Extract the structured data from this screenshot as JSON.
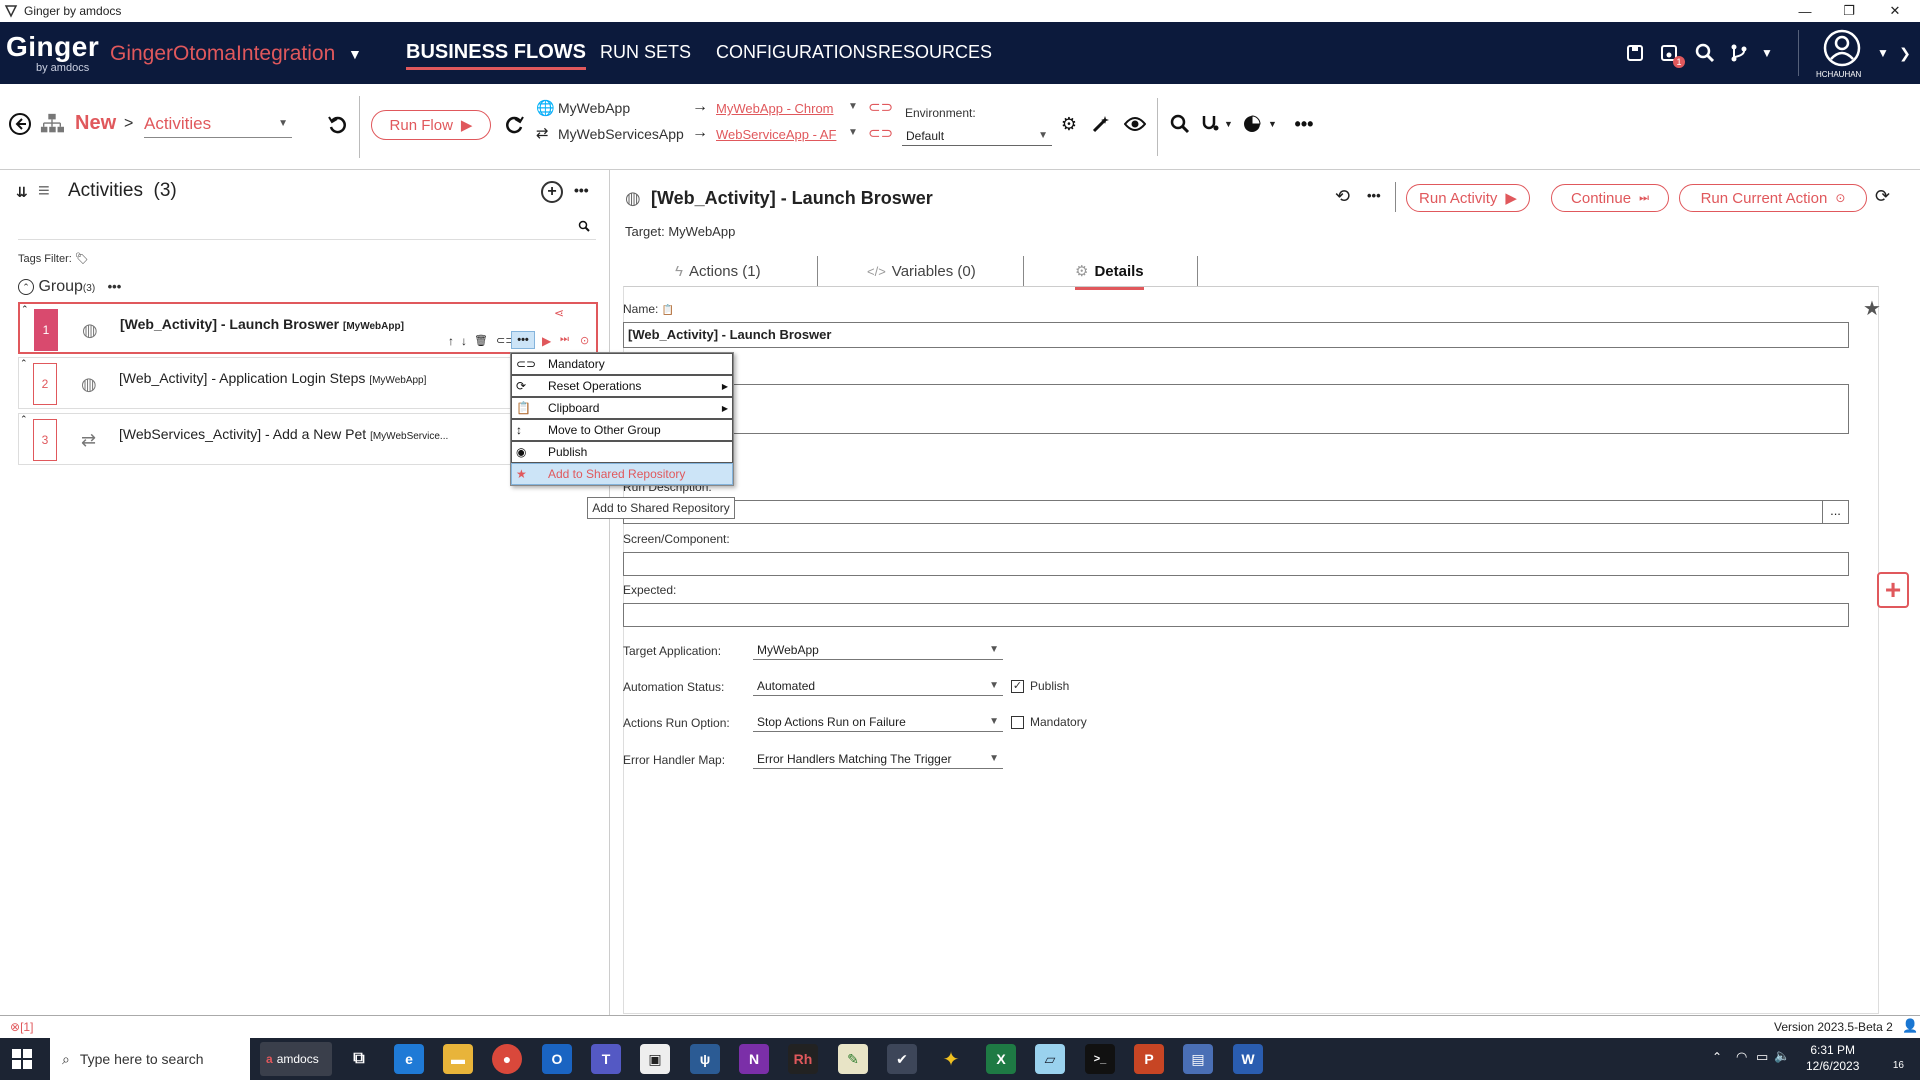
{
  "window": {
    "title": "Ginger by amdocs"
  },
  "topnav": {
    "logo": "Ginger",
    "logo_sub": "by amdocs",
    "solution_name": "GingerOtomaIntegration",
    "tabs": [
      "BUSINESS FLOWS",
      "RUN SETS",
      "CONFIGURATIONS",
      "RESOURCES"
    ],
    "active_tab": "BUSINESS FLOWS",
    "notification_count": "1",
    "user": "HCHAUHAN"
  },
  "toolbar": {
    "crumb_new": "New",
    "crumb_sep": ">",
    "crumb_activities": "Activities",
    "run_flow": "Run Flow",
    "apps": [
      {
        "name": "MyWebApp",
        "agent": "MyWebApp - Chrom"
      },
      {
        "name": "MyWebServicesApp",
        "agent": "WebServiceApp - AF"
      }
    ],
    "environment_label": "Environment:",
    "environment_value": "Default"
  },
  "activities_panel": {
    "title": "Activities",
    "count": "(3)",
    "tags_filter": "Tags Filter:",
    "group_name": "Group",
    "group_count": "(3)",
    "items": [
      {
        "num": "1",
        "title": "[Web_Activity] - Launch Broswer",
        "app": "[MyWebApp]"
      },
      {
        "num": "2",
        "title": "[Web_Activity] - Application Login Steps",
        "app": "[MyWebApp]"
      },
      {
        "num": "3",
        "title": "[WebServices_Activity] - Add a New Pet",
        "app": "[MyWebService..."
      }
    ]
  },
  "context_menu": {
    "items": [
      {
        "label": "Mandatory",
        "submenu": false
      },
      {
        "label": "Reset Operations",
        "submenu": true
      },
      {
        "label": "Clipboard",
        "submenu": true
      },
      {
        "label": "Move to Other Group",
        "submenu": false
      },
      {
        "label": "Publish",
        "submenu": false
      },
      {
        "label": "Add to Shared Repository",
        "submenu": false
      }
    ],
    "tooltip": "Add to Shared Repository"
  },
  "activity_details": {
    "title": "[Web_Activity] - Launch Broswer",
    "target": "Target: MyWebApp",
    "run_activity": "Run Activity",
    "continue": "Continue",
    "run_current_action": "Run Current Action",
    "tabs": [
      "Actions (1)",
      "Variables (0)",
      "Details"
    ],
    "active_tab": "Details",
    "name_label": "Name:",
    "name_value": "[Web_Activity] - Launch Broswer",
    "run_description_label": "Run Description:",
    "screen_label": "Screen/Component:",
    "expected_label": "Expected:",
    "target_app_label": "Target Application:",
    "target_app_value": "MyWebApp",
    "automation_status_label": "Automation Status:",
    "automation_status_value": "Automated",
    "publish_label": "Publish",
    "publish_checked": true,
    "run_option_label": "Actions Run Option:",
    "run_option_value": "Stop Actions Run on Failure",
    "mandatory_label": "Mandatory",
    "mandatory_checked": false,
    "error_handler_label": "Error Handler Map:",
    "error_handler_value": "Error Handlers Matching The Trigger",
    "browse_button": "..."
  },
  "statusbar": {
    "error_count": "[1]",
    "version": "Version 2023.5-Beta 2"
  },
  "taskbar": {
    "search_placeholder": "Type here to search",
    "amdocs_label": "amdocs",
    "time": "6:31 PM",
    "date": "12/6/2023",
    "notif_count": "16"
  },
  "colors": {
    "accent": "#e0585c",
    "nav_bg": "#0c1a3c",
    "selection": "#d94a6e"
  }
}
